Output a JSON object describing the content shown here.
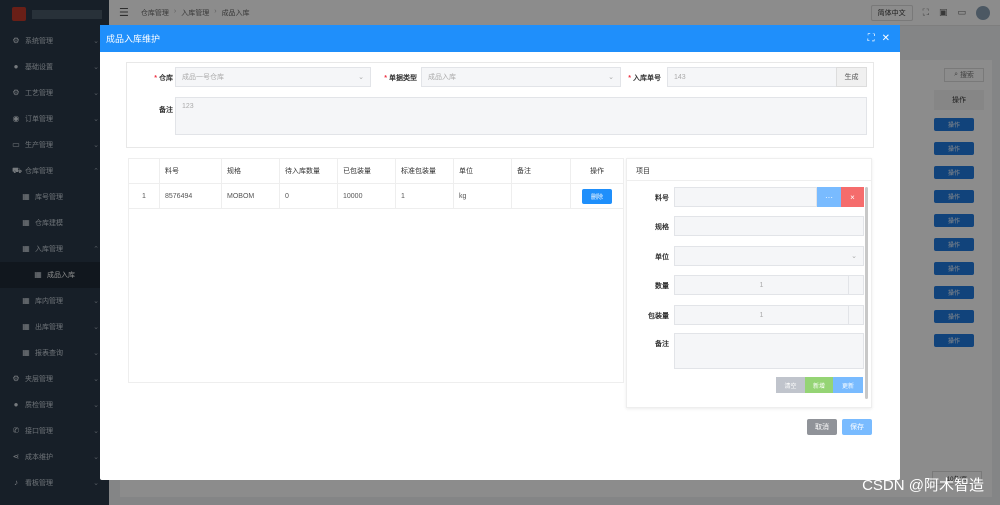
{
  "sidebar": {
    "items": [
      {
        "label": "系统管理",
        "icon": "gear-icon"
      },
      {
        "label": "基础设置",
        "icon": "user-icon"
      },
      {
        "label": "工艺管理",
        "icon": "gear-icon"
      },
      {
        "label": "订单管理",
        "icon": "eye-icon"
      },
      {
        "label": "生产管理",
        "icon": "monitor-icon"
      },
      {
        "label": "仓库管理",
        "icon": "cart-icon"
      },
      {
        "label": "库号管理",
        "icon": "grid-icon"
      },
      {
        "label": "仓库建模",
        "icon": "grid-icon"
      },
      {
        "label": "入库管理",
        "icon": "grid-icon"
      },
      {
        "label": "成品入库",
        "icon": "grid-icon"
      },
      {
        "label": "库内管理",
        "icon": "grid-icon"
      },
      {
        "label": "出库管理",
        "icon": "grid-icon"
      },
      {
        "label": "报表查询",
        "icon": "grid-icon"
      },
      {
        "label": "夹层管理",
        "icon": "gear-icon"
      },
      {
        "label": "质检管理",
        "icon": "bulb-icon"
      },
      {
        "label": "接口管理",
        "icon": "phone-icon"
      },
      {
        "label": "成本维护",
        "icon": "share-icon"
      },
      {
        "label": "看板管理",
        "icon": "bell-icon"
      }
    ]
  },
  "header": {
    "breadcrumb": [
      "仓库管理",
      "入库管理",
      "成品入库"
    ],
    "language": "简体中文"
  },
  "background": {
    "search_label": "搜索",
    "op_col_header": "操作",
    "op_button": "操作",
    "pager_size": "10条/页"
  },
  "dialog": {
    "title": "成品入库维护",
    "form": {
      "warehouse_label": "仓库",
      "warehouse_value": "成品一号仓库",
      "doc_type_label": "单据类型",
      "doc_type_value": "成品入库",
      "in_no_label": "入库单号",
      "in_no_value": "143",
      "generate_button": "生成",
      "remark_label": "备注",
      "remark_value": "123"
    },
    "table": {
      "headers": [
        "",
        "料号",
        "规格",
        "待入库数量",
        "已包装量",
        "标准包装量",
        "单位",
        "备注",
        "操作"
      ],
      "rows": [
        {
          "index": "1",
          "part_no": "8576494",
          "spec": "MOBOM",
          "pending_qty": "0",
          "packed_qty": "10000",
          "std_pack": "1",
          "unit": "kg",
          "remark": "",
          "delete": "删除"
        }
      ]
    },
    "item_panel": {
      "title": "项目",
      "part_no_label": "料号",
      "more_button": "···",
      "clear_button": "×",
      "spec_label": "规格",
      "unit_label": "单位",
      "qty_label": "数量",
      "qty_value": "1",
      "pack_label": "包装量",
      "pack_value": "1",
      "remark_label": "备注",
      "clear_action": "清空",
      "add_action": "新增",
      "update_action": "更新"
    },
    "footer": {
      "cancel": "取消",
      "save": "保存"
    }
  },
  "watermark": "CSDN @阿木智造",
  "colors": {
    "primary": "#1f8ffb",
    "sidebar_bg": "#2b3a4a",
    "danger": "#f56c6c"
  }
}
